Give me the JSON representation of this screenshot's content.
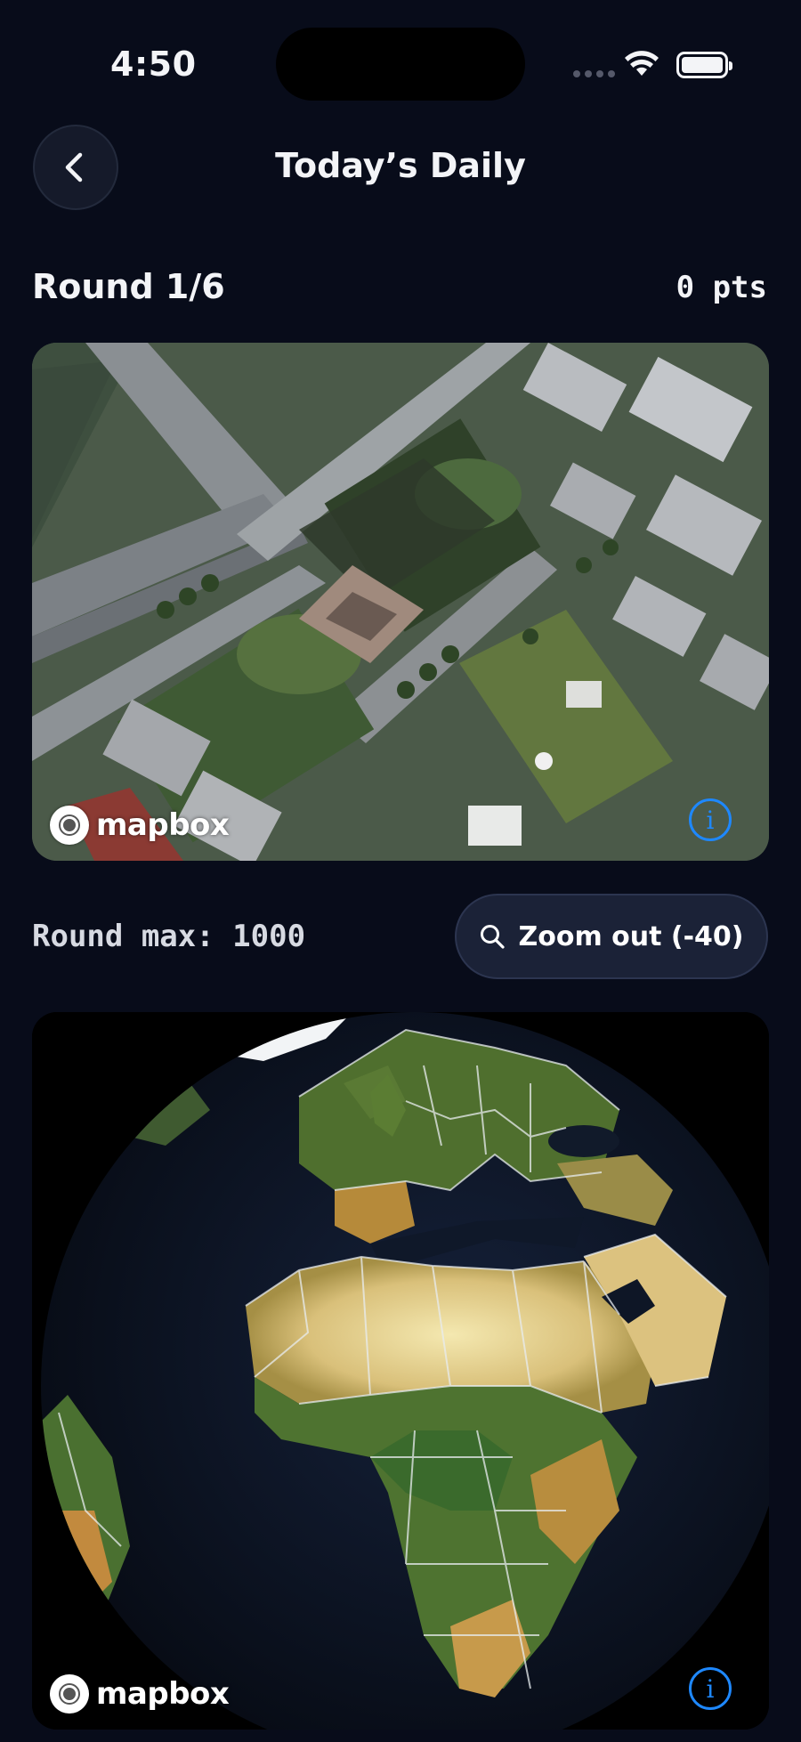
{
  "status_bar": {
    "time": "4:50"
  },
  "header": {
    "title": "Today’s Daily"
  },
  "round": {
    "label": "Round 1/6",
    "points": "0 pts"
  },
  "sat_map": {
    "attribution": "mapbox",
    "info": "i"
  },
  "round_max": {
    "label": "Round max: 1000"
  },
  "zoom_button": {
    "label": "Zoom out (-40)"
  },
  "globe_map": {
    "attribution": "mapbox",
    "info": "i"
  },
  "colors": {
    "background": "#080c1a",
    "accent": "#1e88ff",
    "button": "#1b2237"
  },
  "icons": [
    "chevron-left-icon",
    "search-icon",
    "info-icon",
    "wifi-icon",
    "battery-icon",
    "mapbox-logo-icon"
  ]
}
